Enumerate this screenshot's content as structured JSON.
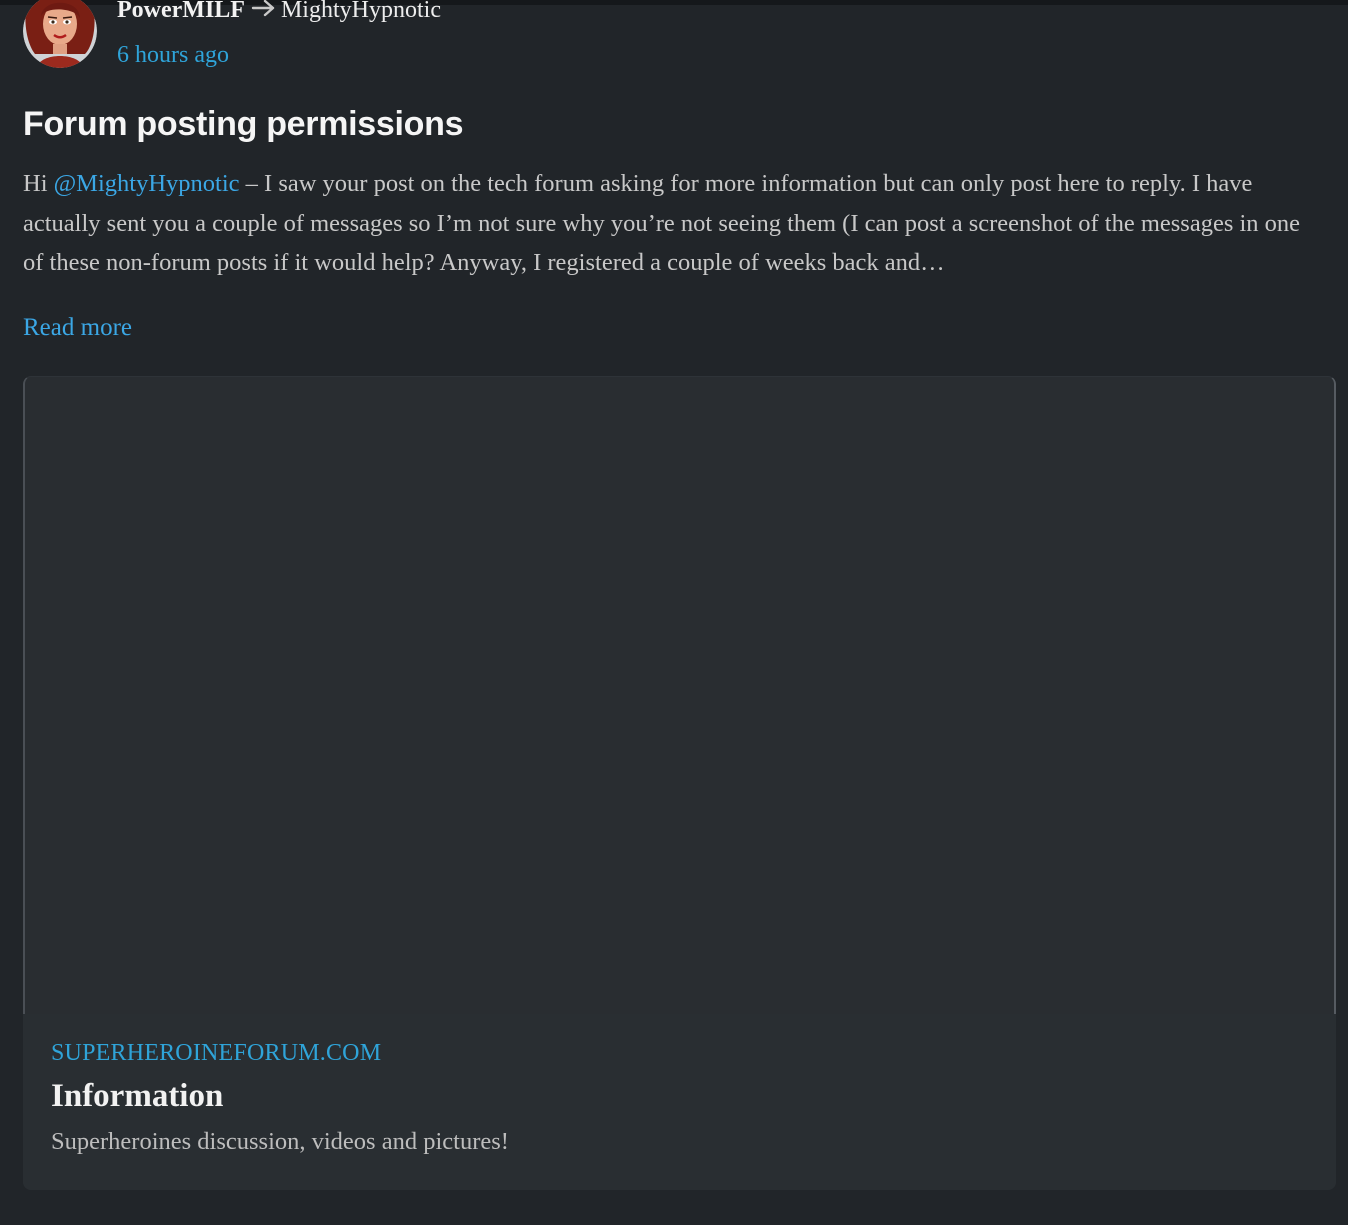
{
  "post": {
    "author": "PowerMILF",
    "recipient": "MightyHypnotic",
    "timestamp": "6 hours ago",
    "title": "Forum posting permissions",
    "excerpt_prefix": "Hi ",
    "mention": "@MightyHypnotic",
    "excerpt_rest": " – I saw your post on the tech forum asking for more information but can only post here to reply. I have actually sent you a couple of messages so I’m not sure why you’re not seeing them (I can post a screenshot of the messages in one of these non-forum posts if it would help? Anyway, I registered a couple of weeks back and…",
    "read_more": "Read more"
  },
  "link_preview": {
    "domain": "SUPERHEROINEFORUM.COM",
    "title": "Information",
    "description": "Superheroines discussion, videos and pictures!"
  },
  "colors": {
    "background": "#212529",
    "card_background": "#292e33",
    "accent_link": "#3ba7e5",
    "timestamp": "#2fa4d9"
  },
  "icons": {
    "arrow": "right-arrow-icon"
  }
}
